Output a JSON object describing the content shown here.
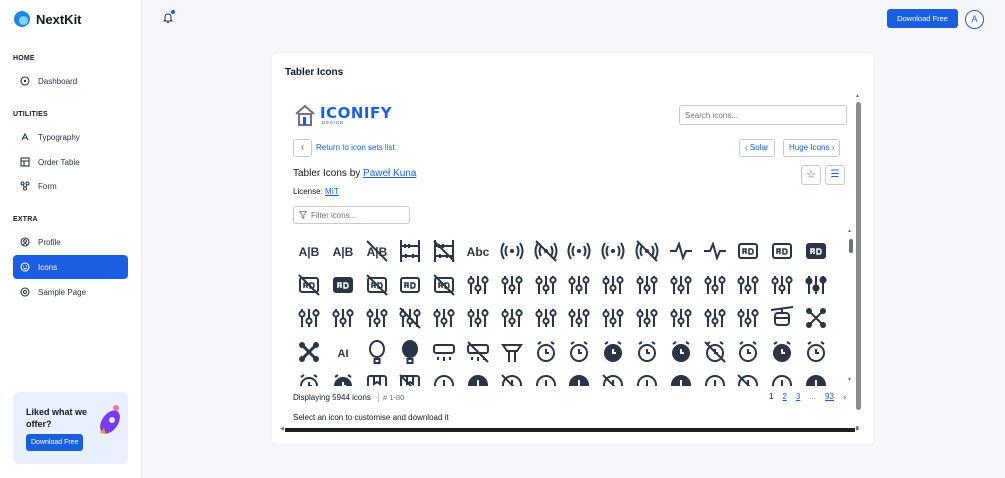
{
  "brand": {
    "name": "NextKit"
  },
  "sidebar": {
    "sections": [
      {
        "title": "HOME",
        "items": [
          {
            "label": "Dashboard",
            "icon": "dashboard-icon"
          }
        ]
      },
      {
        "title": "UTILITIES",
        "items": [
          {
            "label": "Typography",
            "icon": "typography-icon"
          },
          {
            "label": "Order Table",
            "icon": "table-icon"
          },
          {
            "label": "Form",
            "icon": "form-icon"
          }
        ]
      },
      {
        "title": "EXTRA",
        "items": [
          {
            "label": "Profile",
            "icon": "profile-icon"
          },
          {
            "label": "Icons",
            "icon": "smile-icon",
            "active": true
          },
          {
            "label": "Sample Page",
            "icon": "sample-page-icon"
          }
        ]
      }
    ],
    "promo": {
      "text": "Liked what we offer?",
      "button": "Download Free"
    }
  },
  "header": {
    "download_button": "Download Free",
    "avatar_initial": "A"
  },
  "card": {
    "title": "Tabler Icons",
    "logo": {
      "text": "ICONIFY",
      "sub": ".DESIGN"
    },
    "search_placeholder": "Search icons...",
    "back_link": "Return to icon sets list",
    "prev_set": "Solar",
    "next_set": "Huge Icons",
    "set_title_prefix": "Tabler Icons by ",
    "set_author": "Paweł Kuna",
    "license_label": "License: ",
    "license_value": "MIT",
    "filter_placeholder": "Filter icons...",
    "count": "Displaying 5944 icons",
    "range": "# 1-80",
    "pages": [
      "1",
      "2",
      "3",
      "...",
      "93"
    ],
    "hint": "Select an icon to customise and download it"
  },
  "icons": [
    "a-b",
    "a-b-2",
    "a-b-off",
    "abacus",
    "abacus-off",
    "abc",
    "access-point",
    "access-point-off",
    "accessible",
    "accessible-filled",
    "accessible-off",
    "activity",
    "activity-heartbeat",
    "ad",
    "ad-circle",
    "ad-circle-filled",
    "ad-circle-off",
    "ad-filled",
    "ad-off",
    "address-book",
    "address-book-off",
    "adjustments",
    "adjustments-alt",
    "adjustments-bolt",
    "adjustments-cancel",
    "adjustments-check",
    "adjustments-code",
    "adjustments-cog",
    "adjustments-dollar",
    "adjustments-down",
    "adjustments-exclamation",
    "adjustments-filled",
    "adjustments-heart",
    "adjustments-horizontal",
    "adjustments-minus",
    "adjustments-off",
    "adjustments-pause",
    "adjustments-pin",
    "adjustments-plus",
    "adjustments-question",
    "adjustments-search",
    "adjustments-share",
    "adjustments-spark",
    "adjustments-star",
    "adjustments-up",
    "adjustments-x",
    "aerial-lift",
    "affiliate",
    "affiliate-filled",
    "ai",
    "air-balloon",
    "air-balloon-filled",
    "air-conditioning",
    "air-conditioning-disabled",
    "air-traffic-control",
    "alarm",
    "alarm-average",
    "alarm-filled",
    "alarm-minus",
    "alarm-minus-filled",
    "alarm-off",
    "alarm-plus",
    "alarm-plus-filled",
    "alarm-smoke",
    "alarm-snooze",
    "alarm-snooze-filled",
    "album",
    "album-off",
    "alert-circle",
    "alert-circle-filled",
    "alert-circle-off",
    "alert-hexagon",
    "alert-hexagon-filled",
    "alert-hexagon-off",
    "alert-octagon",
    "alert-octagon-filled",
    "alert-small",
    "alert-small-off",
    "alert-square",
    "alert-square-filled"
  ]
}
